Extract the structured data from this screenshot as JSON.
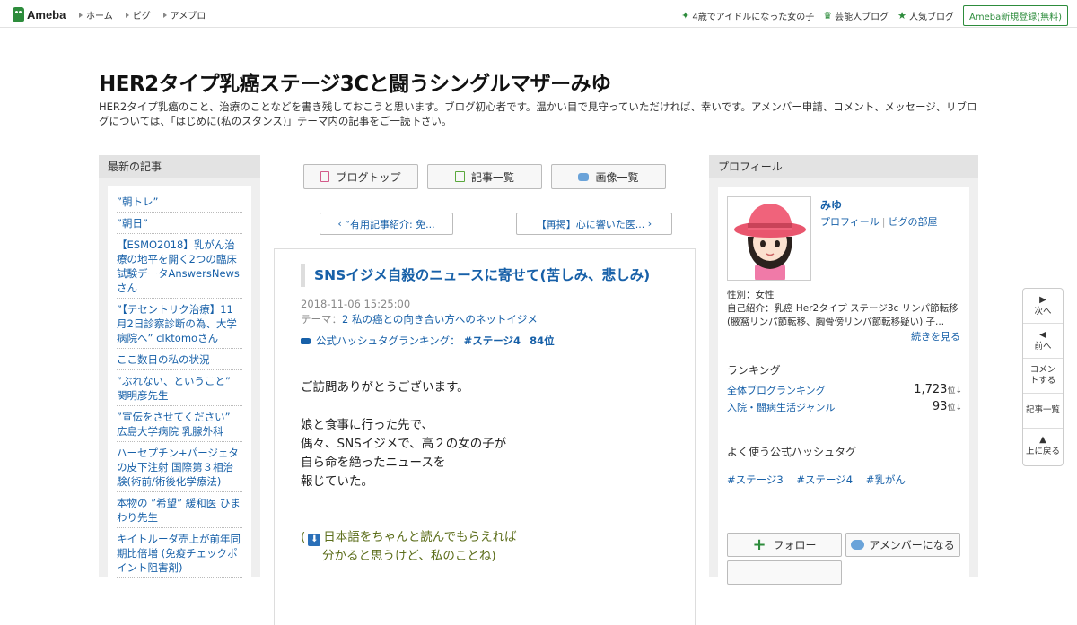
{
  "topbar": {
    "logo": "Ameba",
    "nav": [
      "ホーム",
      "ピグ",
      "アメブロ"
    ],
    "right_links": [
      {
        "icon": "sparkle-icon",
        "label": "4歳でアイドルになった女の子"
      },
      {
        "icon": "crown-icon",
        "label": "芸能人ブログ"
      },
      {
        "icon": "star-icon",
        "label": "人気ブログ"
      }
    ],
    "register": "Ameba新規登録(無料)"
  },
  "header": {
    "title": "HER2タイプ乳癌ステージ3Cと闘うシングルマザーみゆ",
    "description": "HER2タイプ乳癌のこと、治療のことなどを書き残しておこうと思います。ブログ初心者です。温かい目で見守っていただければ、幸いです。アメンバー申請、コメント、メッセージ、リブログについては、「はじめに(私のスタンス)」テーマ内の記事をご一読下さい。"
  },
  "recent": {
    "heading": "最新の記事",
    "items": [
      "”朝トレ”",
      "”朝日”",
      "【ESMO2018】乳がん治療の地平を開く2つの臨床試験データAnswersNewsさん",
      "”【テセントリク治療】11月2日診察診断の為、大学病院へ” clktomoさん",
      "ここ数日の私の状況",
      "”ぶれない、ということ” 関明彦先生",
      "”宣伝をさせてください” 広島大学病院 乳腺外科",
      "ハーセプチン+パージェタの皮下注射 国際第３相治験(術前/術後化学療法)",
      "本物の ”希望” 緩和医 ひまわり先生",
      "キイトルーダ売上が前年同期比倍増 (免疫チェックポイント阻害剤)"
    ]
  },
  "center": {
    "nav": {
      "top": "ブログトップ",
      "list": "記事一覧",
      "images": "画像一覧"
    },
    "prev": "”有用記事紹介: 免...",
    "next": "【再掲】心に響いた医...",
    "article": {
      "title": "SNSイジメ自殺のニュースに寄せて(苦しみ、悲しみ)",
      "date": "2018-11-06 15:25:00",
      "theme_label": "テーマ：",
      "theme": "2 私の癌との向き合い方へのネットイジメ",
      "hash_label": "公式ハッシュタグランキング：",
      "hash_tag": "#ステージ4",
      "hash_rank": "84位",
      "p1": "ご訪問ありがとうございます。",
      "p2_lines": [
        "娘と食事に行った先で、",
        "偶々、SNSイジメで、高２の女の子が",
        "自ら命を絶ったニュースを",
        "報じていた。"
      ],
      "note_open": "(",
      "note_line1": "日本語をちゃんと読んでもらえれば",
      "note_line2": "分かると思うけど、私のことね)"
    }
  },
  "profile": {
    "heading": "プロフィール",
    "name": "みゆ",
    "link_profile": "プロフィール",
    "link_room": "ピグの部屋",
    "gender": "性別：女性",
    "intro": "自己紹介：乳癌 Her2タイプ ステージ3c リンパ節転移 (腋窩リンパ節転移、胸骨傍リンパ節転移疑い) 子...",
    "readmore": "続きを見る",
    "ranking_heading": "ランキング",
    "rankings": [
      {
        "label": "全体ブログランキング",
        "value": "1,723",
        "unit": "位",
        "trend": "↓"
      },
      {
        "label": "入院・闘病生活ジャンル",
        "value": "93",
        "unit": "位",
        "trend": "↓"
      }
    ],
    "hash_heading": "よく使う公式ハッシュタグ",
    "hashtags": [
      "#ステージ3",
      "#ステージ4",
      "#乳がん"
    ],
    "follow": "フォロー",
    "amember": "アメンバーになる"
  },
  "sidenav": [
    {
      "arrow": "▶",
      "label": "次へ"
    },
    {
      "arrow": "◀",
      "label": "前へ"
    },
    {
      "arrow": "",
      "label": "コメントする"
    },
    {
      "arrow": "",
      "label": "記事一覧"
    },
    {
      "arrow": "▲",
      "label": "上に戻る"
    }
  ]
}
